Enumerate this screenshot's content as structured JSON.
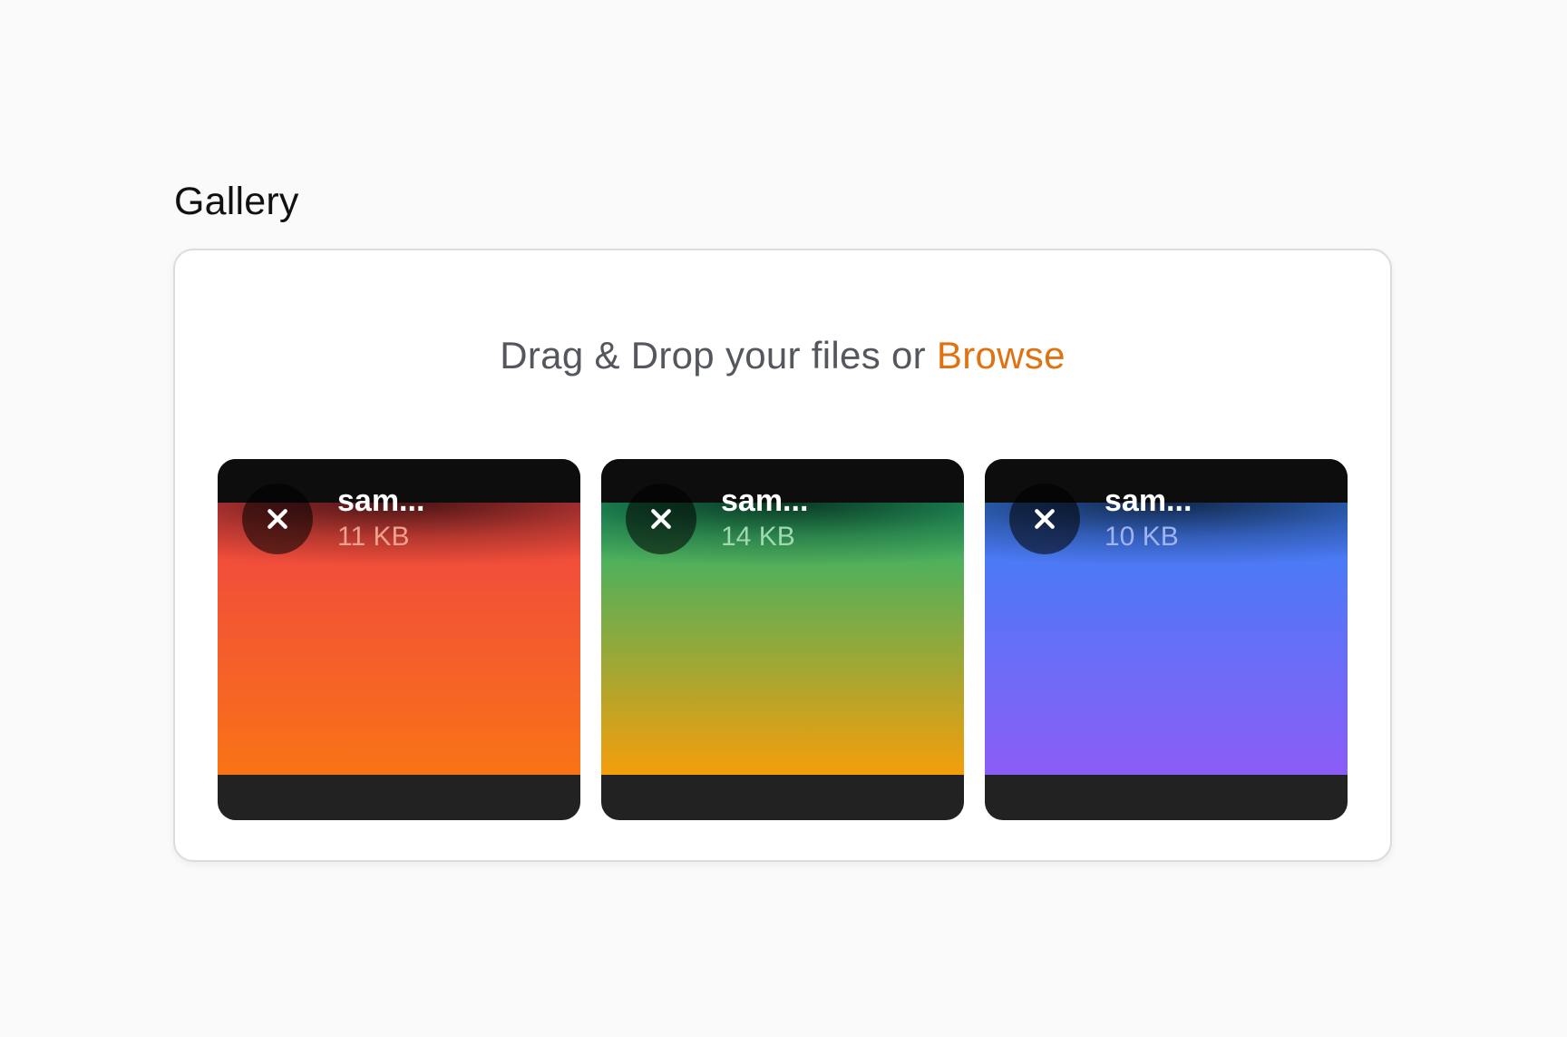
{
  "gallery": {
    "label": "Gallery",
    "drop_text": "Drag & Drop your files or ",
    "browse_label": "Browse",
    "files": [
      {
        "name": "sam...",
        "size": "11 KB",
        "gradient_colors": [
          "#ef4444",
          "#f97316"
        ],
        "size_color": "#f0a08e"
      },
      {
        "name": "sam...",
        "size": "14 KB",
        "gradient_colors": [
          "#22b573",
          "#f59e0b"
        ],
        "size_color": "#9fd9b0"
      },
      {
        "name": "sam...",
        "size": "10 KB",
        "gradient_colors": [
          "#3b82f6",
          "#8b5cf6"
        ],
        "size_color": "#9fb2f2"
      }
    ]
  },
  "colors": {
    "accent": "#e07212",
    "panel_border": "#dcdcdc",
    "page_background": "#fafafa"
  }
}
